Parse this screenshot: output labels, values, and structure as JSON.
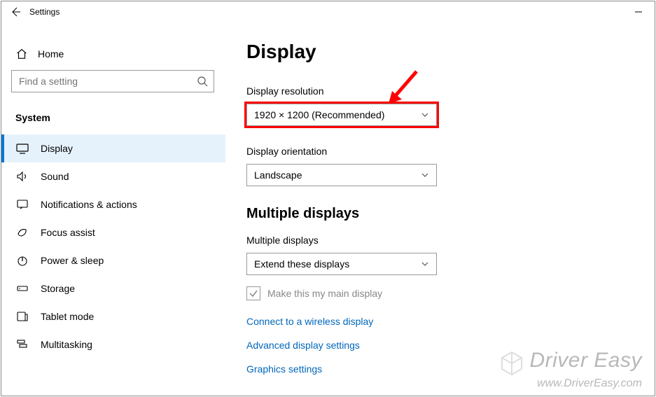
{
  "titlebar": {
    "title": "Settings"
  },
  "sidebar": {
    "home_label": "Home",
    "search_placeholder": "Find a setting",
    "category": "System",
    "items": [
      {
        "label": "Display",
        "active": true
      },
      {
        "label": "Sound",
        "active": false
      },
      {
        "label": "Notifications & actions",
        "active": false
      },
      {
        "label": "Focus assist",
        "active": false
      },
      {
        "label": "Power & sleep",
        "active": false
      },
      {
        "label": "Storage",
        "active": false
      },
      {
        "label": "Tablet mode",
        "active": false
      },
      {
        "label": "Multitasking",
        "active": false
      }
    ]
  },
  "main": {
    "page_title": "Display",
    "resolution": {
      "label": "Display resolution",
      "value": "1920 × 1200 (Recommended)"
    },
    "orientation": {
      "label": "Display orientation",
      "value": "Landscape"
    },
    "multiple": {
      "header": "Multiple displays",
      "dropdown_label": "Multiple displays",
      "dropdown_value": "Extend these displays",
      "checkbox_label": "Make this my main display",
      "checkbox_checked": true
    },
    "links": {
      "connect": "Connect to a wireless display",
      "advanced": "Advanced display settings",
      "graphics": "Graphics settings"
    }
  },
  "watermark": {
    "brand": "Driver Easy",
    "url": "www.DriverEasy.com"
  },
  "annotation": {
    "arrow_color": "#ff0000"
  }
}
